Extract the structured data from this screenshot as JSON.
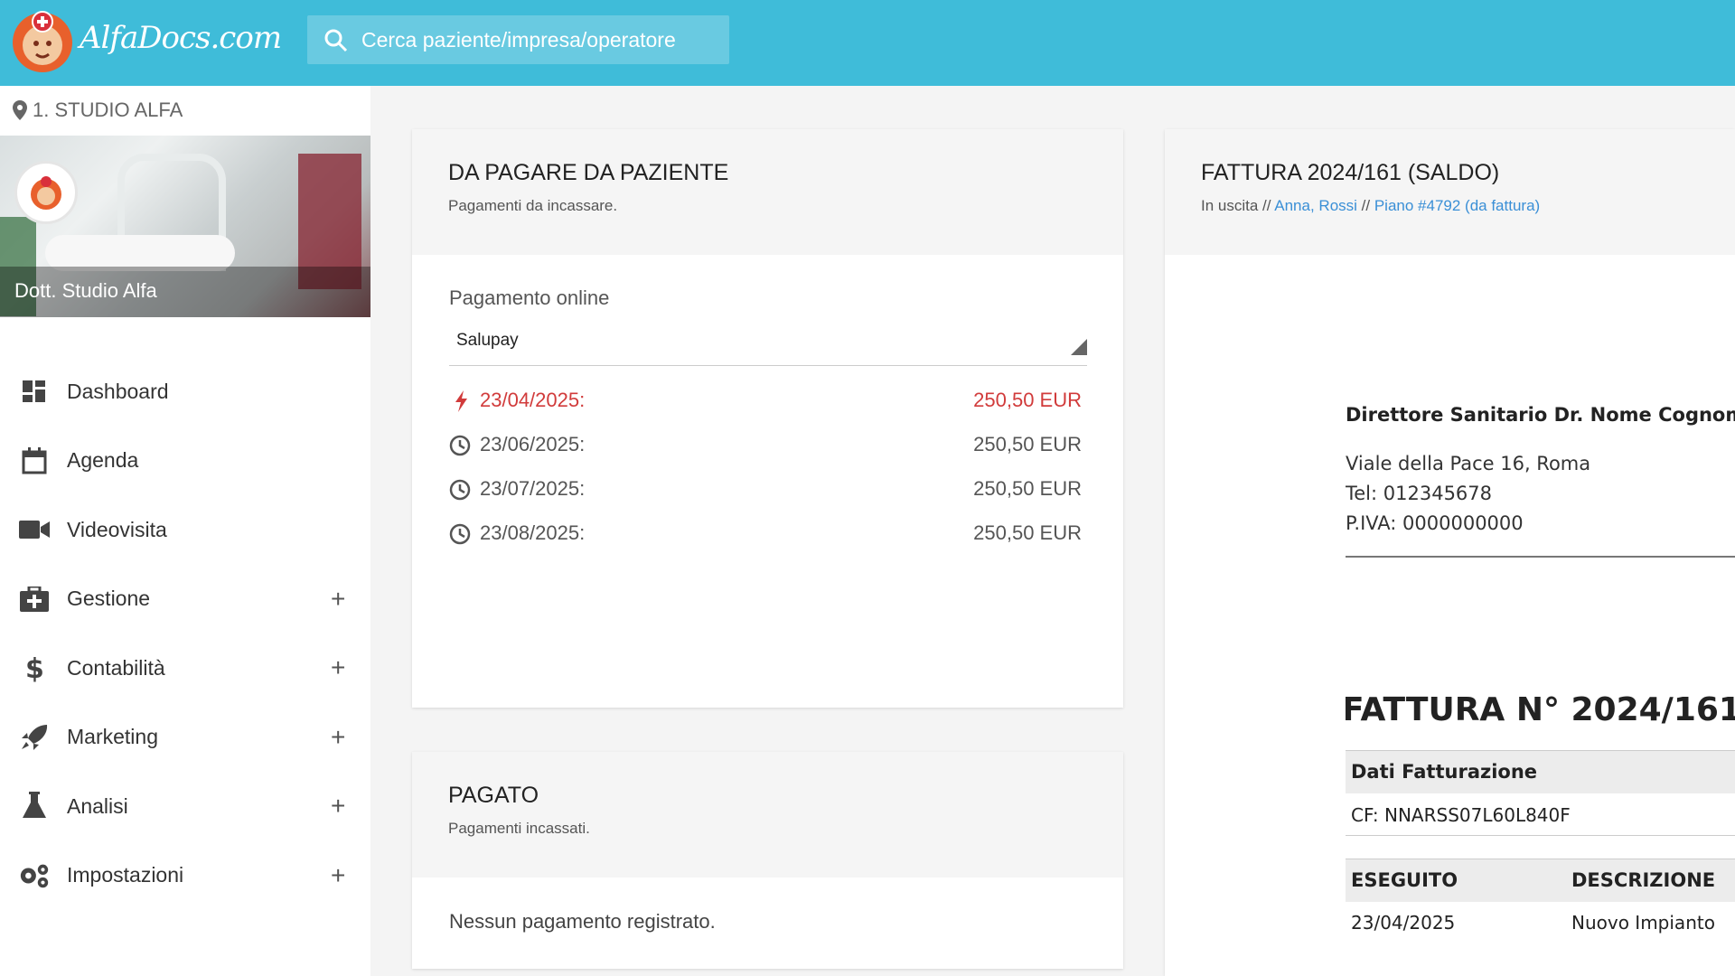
{
  "header": {
    "brand": "AlfaDocs.com",
    "search_placeholder": "Cerca paziente/impresa/operatore"
  },
  "sidebar": {
    "location": "1. STUDIO ALFA",
    "studio_name": "Dott. Studio Alfa",
    "items": [
      {
        "label": "Dashboard",
        "icon": "dashboard-icon",
        "expandable": false
      },
      {
        "label": "Agenda",
        "icon": "calendar-icon",
        "expandable": false
      },
      {
        "label": "Videovisita",
        "icon": "video-camera-icon",
        "expandable": false
      },
      {
        "label": "Gestione",
        "icon": "medical-kit-icon",
        "expandable": true
      },
      {
        "label": "Contabilità",
        "icon": "dollar-icon",
        "expandable": true
      },
      {
        "label": "Marketing",
        "icon": "rocket-icon",
        "expandable": true
      },
      {
        "label": "Analisi",
        "icon": "flask-icon",
        "expandable": true
      },
      {
        "label": "Impostazioni",
        "icon": "gears-icon",
        "expandable": true
      }
    ],
    "expand_symbol": "+"
  },
  "to_pay": {
    "title": "DA PAGARE DA PAZIENTE",
    "subtitle": "Pagamenti da incassare.",
    "method_label": "Pagamento online",
    "method_value": "Salupay",
    "installments": [
      {
        "date": "23/04/2025:",
        "amount": "250,50 EUR",
        "status": "due",
        "icon": "lightning-icon"
      },
      {
        "date": "23/06/2025:",
        "amount": "250,50 EUR",
        "status": "future",
        "icon": "clock-icon"
      },
      {
        "date": "23/07/2025:",
        "amount": "250,50 EUR",
        "status": "future",
        "icon": "clock-icon"
      },
      {
        "date": "23/08/2025:",
        "amount": "250,50 EUR",
        "status": "future",
        "icon": "clock-icon"
      }
    ]
  },
  "paid": {
    "title": "PAGATO",
    "subtitle": "Pagamenti incassati.",
    "empty_text": "Nessun pagamento registrato."
  },
  "invoice": {
    "title": "FATTURA 2024/161 (SALDO)",
    "sub_prefix": "In uscita // ",
    "patient_link": "Anna, Rossi",
    "sep": " // ",
    "plan_link": "Piano #4792 (da fattura)",
    "doc": {
      "director": "Direttore Sanitario Dr. Nome Cognome",
      "address": "Viale della Pace 16, Roma",
      "tel": "Tel: 012345678",
      "piva": "P.IVA: 0000000000",
      "heading": "FATTURA N° 2024/161",
      "billing_header": "Dati Fatturazione",
      "cf": "CF: NNARSS07L60L840F",
      "col_done": "ESEGUITO",
      "col_desc": "DESCRIZIONE",
      "row_date": "23/04/2025",
      "row_desc": "Nuovo Impianto"
    }
  },
  "colors": {
    "topbar": "#3fbcd9",
    "due": "#d13b3b",
    "link": "#3a8fd6"
  }
}
